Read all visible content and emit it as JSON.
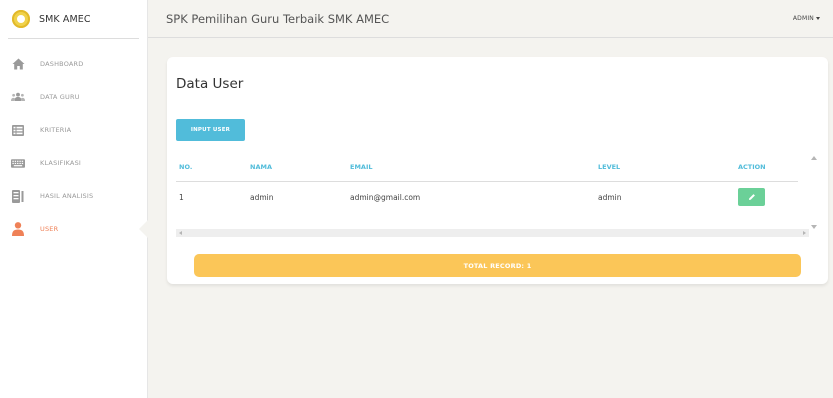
{
  "app": {
    "brand": "SMK AMEC",
    "page_header": "SPK Pemilihan Guru Terbaik SMK AMEC",
    "user_menu": "ADMIN"
  },
  "sidebar": {
    "items": [
      {
        "label": "DASHBOARD",
        "icon": "home-icon",
        "active": false
      },
      {
        "label": "DATA GURU",
        "icon": "users-icon",
        "active": false
      },
      {
        "label": "KRITERIA",
        "icon": "list-icon",
        "active": false
      },
      {
        "label": "KLASIFIKASI",
        "icon": "keyboard-icon",
        "active": false
      },
      {
        "label": "HASIL ANALISIS",
        "icon": "report-icon",
        "active": false
      },
      {
        "label": "USER",
        "icon": "user-icon",
        "active": true
      }
    ]
  },
  "card": {
    "title": "Data User",
    "input_button": "INPUT USER",
    "table": {
      "headers": [
        "NO.",
        "NAMA",
        "EMAIL",
        "LEVEL",
        "ACTION"
      ],
      "rows": [
        {
          "no": "1",
          "nama": "admin",
          "email": "admin@gmail.com",
          "level": "admin"
        }
      ]
    },
    "total_record": "TOTAL RECORD: 1"
  },
  "colors": {
    "accent_info": "#51bcda",
    "accent_success": "#6bd098",
    "accent_warning": "#fbc658",
    "accent_active": "#ef8157",
    "background": "#f4f3ef"
  }
}
